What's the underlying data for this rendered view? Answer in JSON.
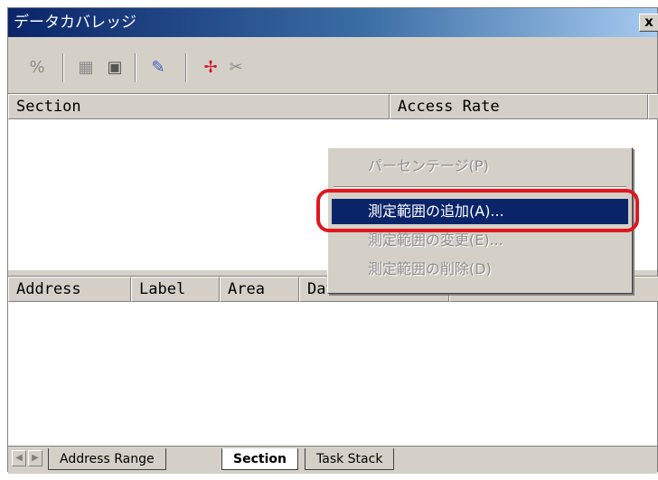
{
  "window": {
    "title": "データカバレッジ",
    "close_label": "x"
  },
  "toolbar": {
    "buttons": [
      {
        "icon": "percent-icon",
        "glyph": "%"
      },
      {
        "icon": "grid-icon",
        "glyph": "▦"
      },
      {
        "icon": "chart-icon",
        "glyph": "▣"
      },
      {
        "icon": "broom-icon",
        "glyph": "✎"
      },
      {
        "icon": "add-range-icon",
        "glyph": "✢"
      },
      {
        "icon": "remove-range-icon",
        "glyph": "✂"
      }
    ]
  },
  "upper_table": {
    "columns": [
      "Section",
      "Access Rate"
    ]
  },
  "lower_table": {
    "columns": [
      "Address",
      "Label",
      "Area",
      "Data"
    ]
  },
  "tabs": [
    "Address Range",
    "Section",
    "Task Stack"
  ],
  "active_tab": "Section",
  "context_menu": {
    "items": [
      {
        "label": "パーセンテージ(P)",
        "state": "disabled"
      },
      {
        "label": "測定範囲の追加(A)...",
        "state": "selected"
      },
      {
        "label": "測定範囲の変更(E)...",
        "state": "disabled"
      },
      {
        "label": "測定範囲の削除(D)",
        "state": "disabled"
      }
    ]
  },
  "colors": {
    "titlebar": "#0a246a",
    "selection": "#0a246a",
    "highlight_ring": "#e0171f",
    "add_icon": "#d0142c"
  }
}
